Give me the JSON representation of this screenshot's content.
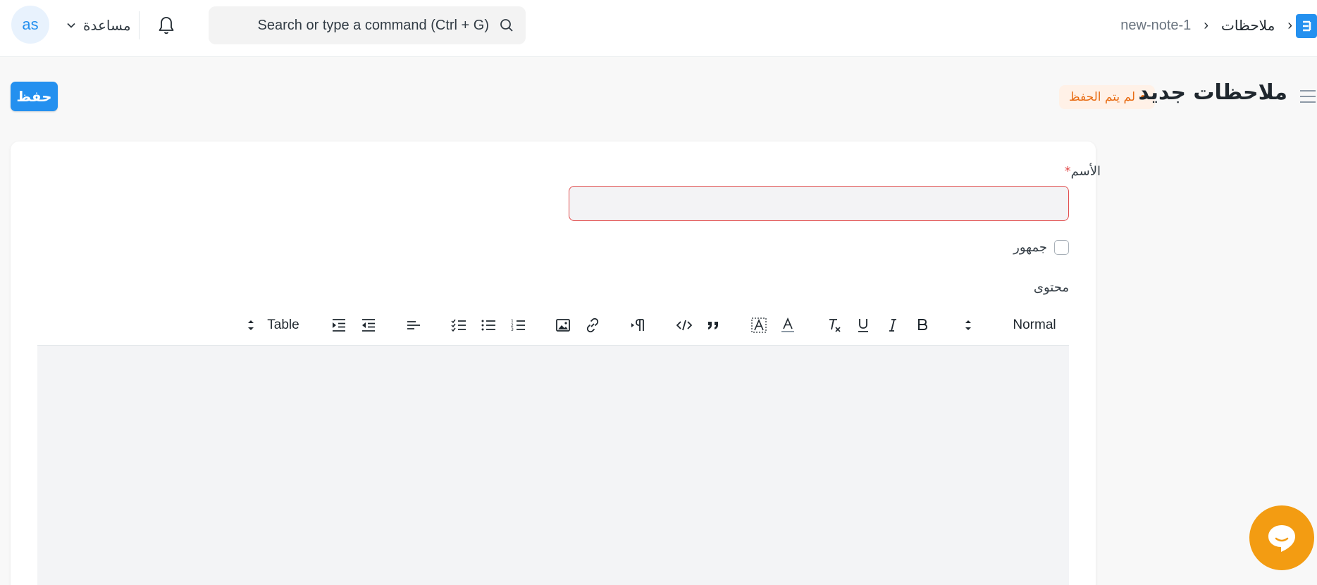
{
  "navbar": {
    "avatar_initials": "as",
    "help_label": "مساعدة",
    "search_placeholder": "Search or type a command (Ctrl + G)",
    "breadcrumbs": [
      "ملاحظات",
      "new-note-1"
    ]
  },
  "page": {
    "title": "ملاحظات جديد",
    "status": "لم يتم الحفظ",
    "save_label": "حفظ"
  },
  "form": {
    "name_label": "الأسم",
    "name_required": "*",
    "name_value": "",
    "public_label": "جمهور",
    "public_checked": false,
    "content_label": "محتوى"
  },
  "editor": {
    "heading_select": "Normal",
    "table_select": "Table",
    "tools": [
      "bold-icon",
      "italic-icon",
      "underline-icon",
      "clear-format-icon",
      "text-color-icon",
      "background-color-icon",
      "blockquote-icon",
      "code-icon",
      "text-direction-icon",
      "link-icon",
      "image-icon",
      "numbered-list-icon",
      "bullet-list-icon",
      "check-list-icon",
      "align-icon",
      "outdent-icon",
      "indent-icon"
    ]
  },
  "colors": {
    "primary": "#2490ef",
    "status_orange": "#e86c13",
    "error_red": "#e24c4c",
    "chat": "#f39c12"
  }
}
